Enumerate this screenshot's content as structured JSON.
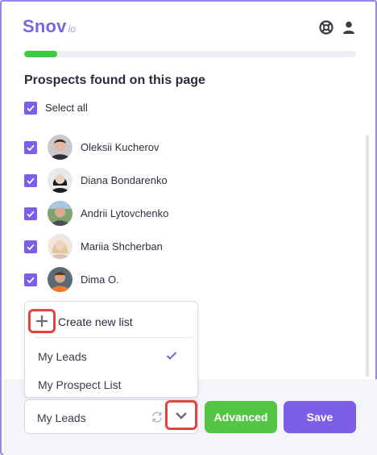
{
  "header": {
    "logo_main": "Snov",
    "logo_sub": "io",
    "help_icon": "lifebuoy-icon",
    "user_icon": "user-icon"
  },
  "progress": {
    "percent": 10,
    "color": "#3fcb3f"
  },
  "title": "Prospects found on this page",
  "select_all": {
    "label": "Select all",
    "checked": true
  },
  "prospects": [
    {
      "name": "Oleksii Kucherov",
      "checked": true
    },
    {
      "name": "Diana Bondarenko",
      "checked": true
    },
    {
      "name": "Andrii Lytovchenko",
      "checked": true
    },
    {
      "name": "Mariia Shcherban",
      "checked": true
    },
    {
      "name": "Dima O.",
      "checked": true
    }
  ],
  "dropdown": {
    "create_label": "Create new list",
    "options": [
      {
        "label": "My Leads",
        "selected": true
      },
      {
        "label": "My Prospect List",
        "selected": false
      }
    ]
  },
  "list_select": {
    "value": "My Leads"
  },
  "buttons": {
    "advanced": "Advanced",
    "save": "Save"
  },
  "colors": {
    "brand": "#7a66e0",
    "checkbox": "#7b5fe6",
    "advanced": "#55c546",
    "save": "#7b5fe6",
    "highlight": "#e0443d"
  }
}
